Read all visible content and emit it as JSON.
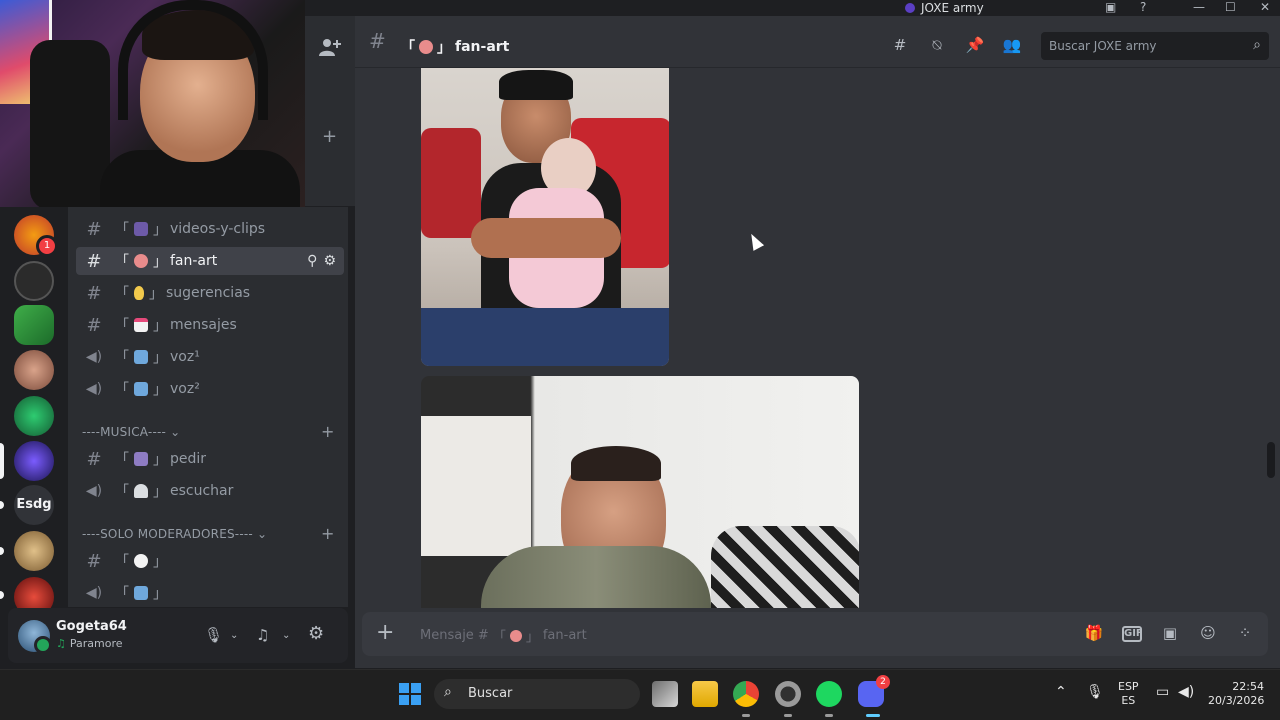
{
  "window": {
    "title": "JOXE army",
    "controls": [
      "—",
      "☐",
      "✕"
    ]
  },
  "channel_header": {
    "name": "fan-art",
    "bracket_open": "「",
    "bracket_close": "」",
    "search_placeholder": "Buscar JOXE army"
  },
  "servers": {
    "text_server": "Esdg",
    "badge": "1",
    "colors": [
      "#c0392b",
      "#2b2b2b",
      "#3fae49",
      "#b36a5e",
      "#1f7a3f",
      "#3b2a8c",
      "#c9a16a",
      "#b32020"
    ]
  },
  "channels": [
    {
      "type": "text",
      "name": "videos-y-clips",
      "emoji": "gamepad"
    },
    {
      "type": "text",
      "name": "fan-art",
      "emoji": "palette",
      "active": true
    },
    {
      "type": "text",
      "name": "sugerencias",
      "emoji": "ear"
    },
    {
      "type": "text",
      "name": "mensajes",
      "emoji": "envelope"
    },
    {
      "type": "voice",
      "name": "voz¹",
      "emoji": "speaker"
    },
    {
      "type": "voice",
      "name": "voz²",
      "emoji": "speaker"
    }
  ],
  "categories": {
    "musica": "----MUSICA----",
    "moderadores": "----SOLO MODERADORES----"
  },
  "musica_channels": [
    {
      "type": "text",
      "name": "pedir",
      "emoji": "notes"
    },
    {
      "type": "voice",
      "name": "escuchar",
      "emoji": "headphones"
    }
  ],
  "mod_channels": [
    {
      "type": "text",
      "name": "",
      "emoji": "speech"
    },
    {
      "type": "voice",
      "name": "",
      "emoji": "speaker"
    }
  ],
  "user": {
    "name": "Gogeta64",
    "status": "Paramore"
  },
  "composer": {
    "placeholder_prefix": "Mensaje #",
    "channel": "fan-art"
  },
  "taskbar": {
    "search": "Buscar",
    "lang_top": "ESP",
    "lang_bottom": "ES",
    "time": "22:54",
    "date": "20/3/2026",
    "discord_badge": "2"
  }
}
